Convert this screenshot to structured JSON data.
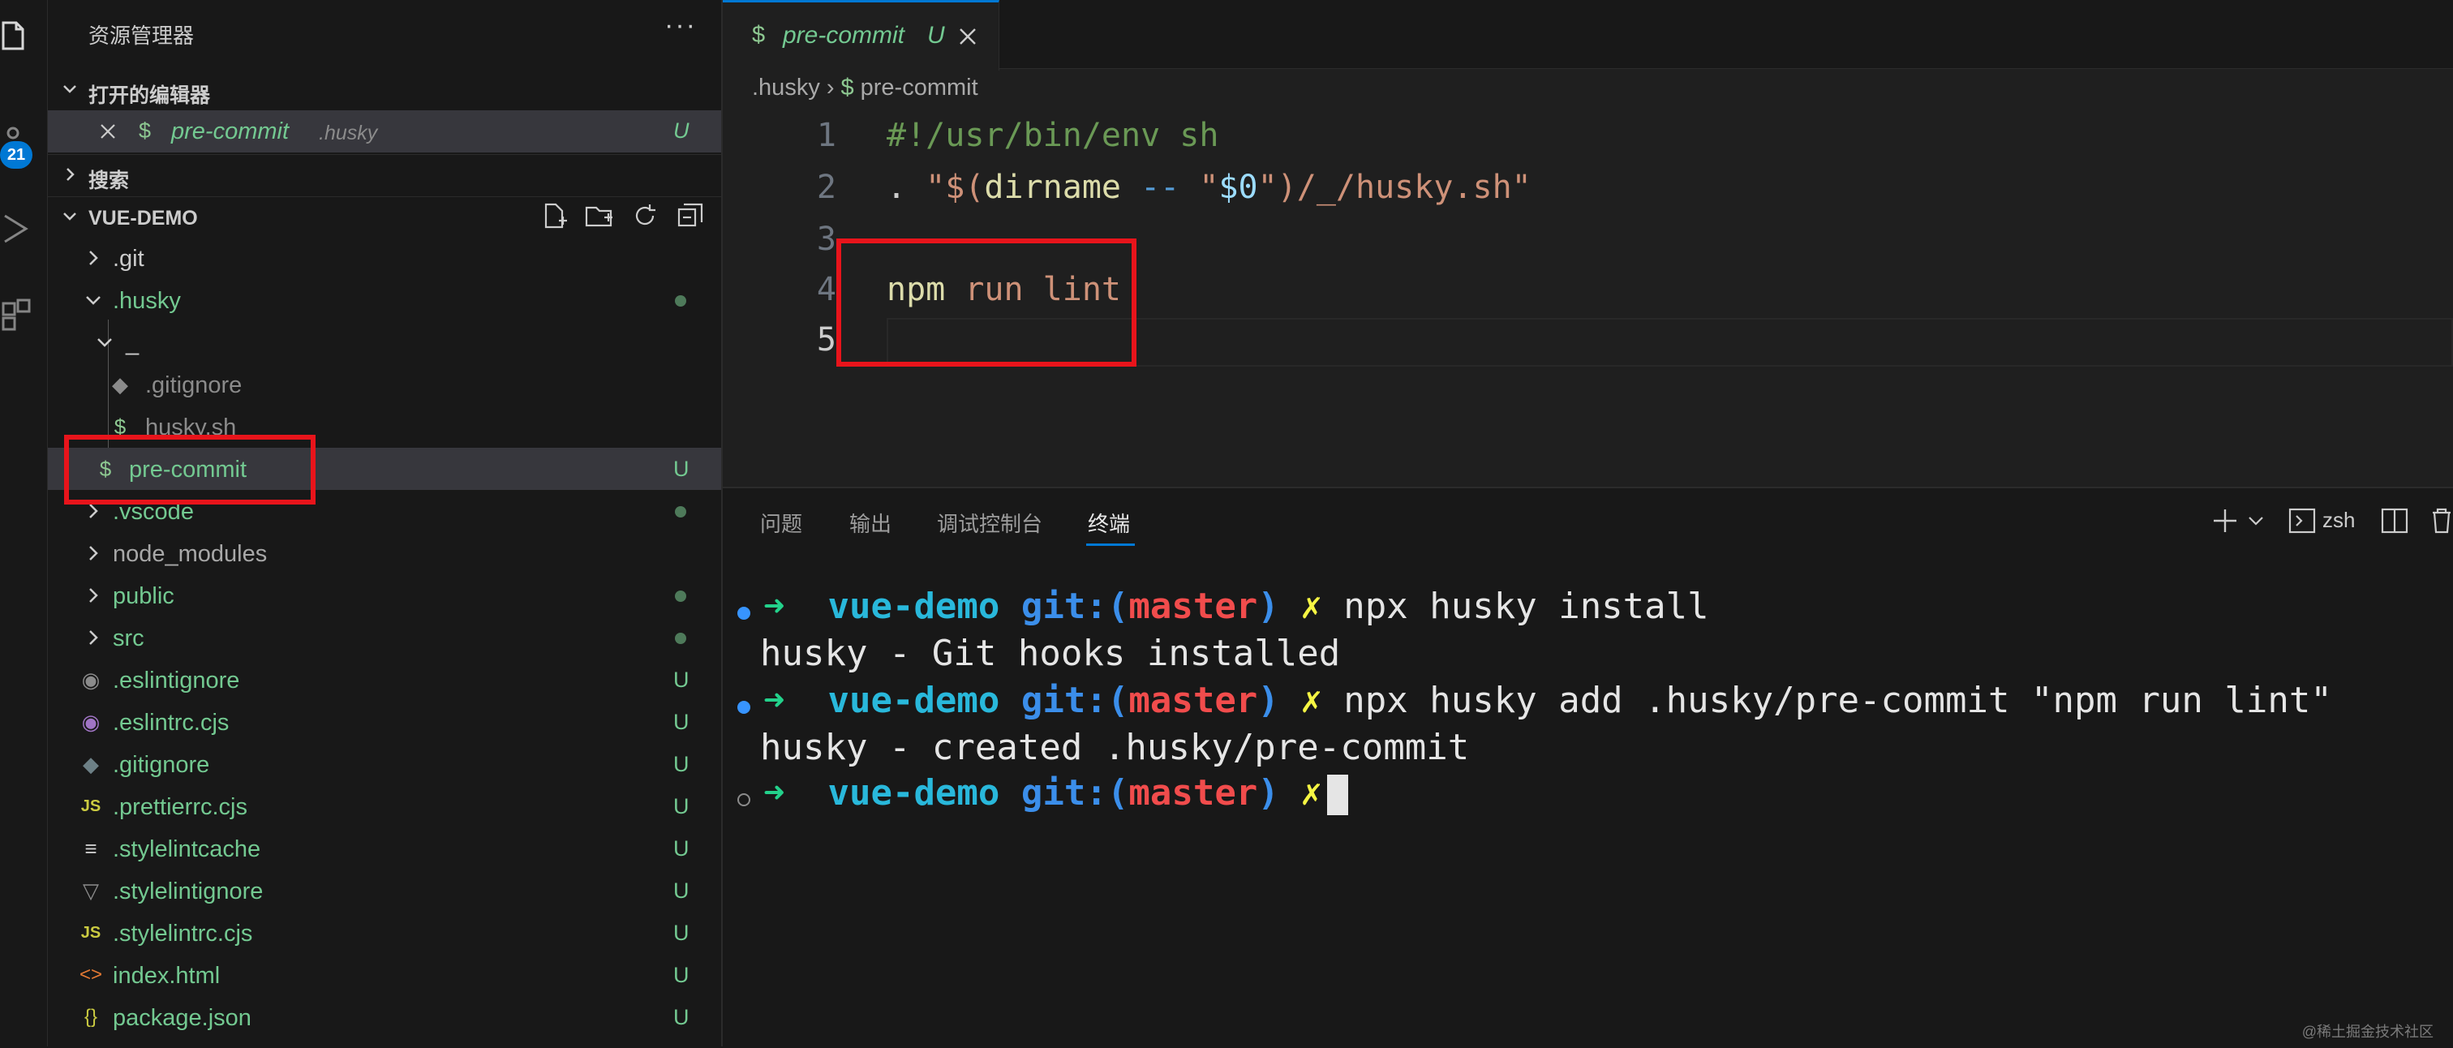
{
  "sidebar": {
    "title": "资源管理器",
    "more": "···",
    "open_editors_label": "打开的编辑器",
    "open_editor": {
      "name": "pre-commit",
      "folder": ".husky",
      "status": "U"
    },
    "search_label": "搜索",
    "project_label": "VUE-DEMO",
    "tree": [
      {
        "label": ".git"
      },
      {
        "label": ".husky"
      },
      {
        "label": "_"
      },
      {
        "label": ".gitignore"
      },
      {
        "label": "husky.sh"
      },
      {
        "label": "pre-commit",
        "status": "U"
      },
      {
        "label": ".vscode"
      },
      {
        "label": "node_modules"
      },
      {
        "label": "public"
      },
      {
        "label": "src"
      },
      {
        "label": ".eslintignore",
        "status": "U"
      },
      {
        "label": ".eslintrc.cjs",
        "status": "U"
      },
      {
        "label": ".gitignore",
        "status": "U"
      },
      {
        "label": ".prettierrc.cjs",
        "status": "U"
      },
      {
        "label": ".stylelintcache",
        "status": "U"
      },
      {
        "label": ".stylelintignore",
        "status": "U"
      },
      {
        "label": ".stylelintrc.cjs",
        "status": "U"
      },
      {
        "label": "index.html",
        "status": "U"
      },
      {
        "label": "package.json",
        "status": "U"
      }
    ]
  },
  "activity": {
    "badge": "21"
  },
  "editor": {
    "tab": {
      "icon": "$",
      "name": "pre-commit",
      "status": "U"
    },
    "breadcrumb": [
      ".husky",
      "pre-commit"
    ],
    "line_numbers": [
      "1",
      "2",
      "3",
      "4",
      "5"
    ],
    "lines": {
      "l1": "#!/usr/bin/env sh",
      "l2": {
        "dot": ". ",
        "q1": "\"$(",
        "fn": "dirname",
        "op": " -- ",
        "q2": "\"",
        "var": "$0",
        "rest": "\")/_/husky.sh\""
      },
      "l4": {
        "cmd": "npm",
        "args": " run lint"
      }
    }
  },
  "panel": {
    "tabs": [
      "问题",
      "输出",
      "调试控制台",
      "终端"
    ],
    "active_tab": "终端",
    "shell": "zsh",
    "terminal": [
      {
        "dir": "vue-demo",
        "git": "git:(",
        "branch": "master",
        "close": ")",
        "x": "✗",
        "cmd": " npx husky install"
      },
      {
        "output": "husky - Git hooks installed"
      },
      {
        "dir": "vue-demo",
        "git": "git:(",
        "branch": "master",
        "close": ")",
        "x": "✗",
        "cmd": " npx husky add .husky/pre-commit \"npm run lint\""
      },
      {
        "output": "husky - created .husky/pre-commit"
      },
      {
        "dir": "vue-demo",
        "git": "git:(",
        "branch": "master",
        "close": ")",
        "x": "✗",
        "cmd": ""
      }
    ],
    "prompt_arrow": "➜"
  },
  "watermark": "@稀土掘金技术社区",
  "colors": {
    "accent": "#0078d4",
    "git_untracked": "#73c991",
    "highlight_box": "#e8141b"
  }
}
